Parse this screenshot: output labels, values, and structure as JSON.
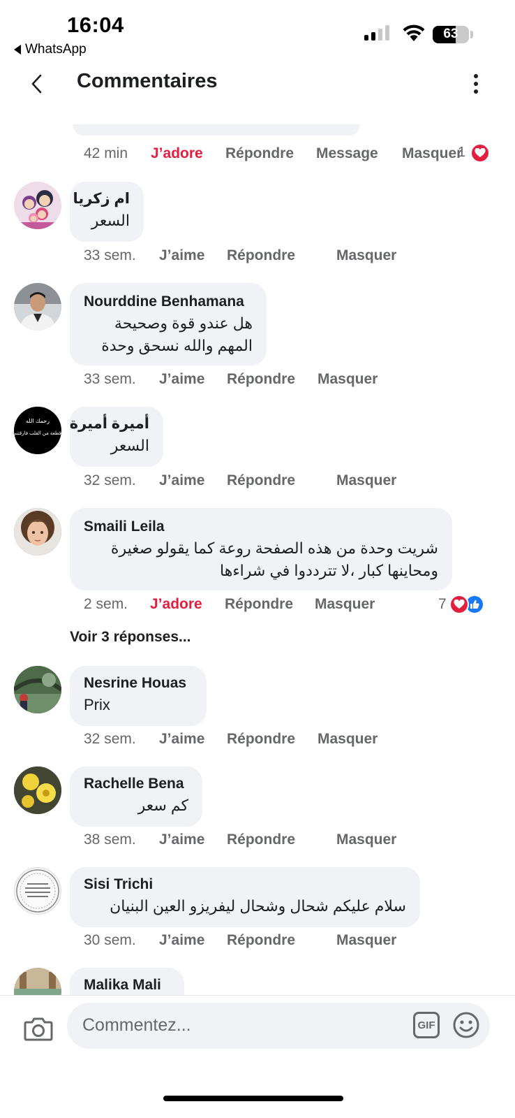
{
  "status_bar": {
    "time": "16:04",
    "back_app": "WhatsApp",
    "battery": "63",
    "battery_level": 0.63
  },
  "header": {
    "title": "Commentaires"
  },
  "top_actions": {
    "time": "42 min",
    "like": "J’adore",
    "reply": "Répondre",
    "message": "Message",
    "hide": "Masquer",
    "count": "1"
  },
  "comments": [
    {
      "name": "ام زكريا",
      "text": [
        "السعر"
      ],
      "time": "33 sem.",
      "like": "J’aime",
      "reply": "Répondre",
      "hide": "Masquer"
    },
    {
      "name": "Nourddine Benhamana",
      "text": [
        "هل عندو قوة وصحيحة",
        "المهم والله نسحق وحدة"
      ],
      "time": "33 sem.",
      "like": "J’aime",
      "reply": "Répondre",
      "hide": "Masquer"
    },
    {
      "name": "أميرة أميرة",
      "text": [
        "السعر"
      ],
      "time": "32 sem.",
      "like": "J’aime",
      "reply": "Répondre",
      "hide": "Masquer"
    },
    {
      "name": "Smaili Leila",
      "text": [
        "شريت وحدة من هذه الصفحة روعة كما يقولو صغيرة",
        "ومحاينها كبار ،لا تترددوا  في شراءها"
      ],
      "time": "2 sem.",
      "like": "J’adore",
      "reply": "Répondre",
      "hide": "Masquer",
      "reactions": "7",
      "more_replies": "Voir 3 réponses..."
    },
    {
      "name": "Nesrine Houas",
      "text": [
        "Prix"
      ],
      "time": "32 sem.",
      "like": "J’aime",
      "reply": "Répondre",
      "hide": "Masquer"
    },
    {
      "name": "Rachelle Bena",
      "text": [
        "كم سعر"
      ],
      "time": "38 sem.",
      "like": "J’aime",
      "reply": "Répondre",
      "hide": "Masquer"
    },
    {
      "name": "Sisi Trichi",
      "text": [
        "سلام عليكم شحال وشحال  ليفريزو العين البنيان"
      ],
      "time": "30 sem.",
      "like": "J’aime",
      "reply": "Répondre",
      "hide": "Masquer"
    },
    {
      "name": "Malika Mali"
    }
  ],
  "avatar_captions": {
    "amira": [
      "رحمك الله",
      "قطعة من القلب فارقتني"
    ]
  },
  "composer": {
    "placeholder": "Commentez...",
    "gif": "GIF"
  },
  "colors": {
    "bubble": "#f0f2f5",
    "love_red": "#e41e3f",
    "like_blue": "#1877f2",
    "secondary_text": "#65676b"
  }
}
